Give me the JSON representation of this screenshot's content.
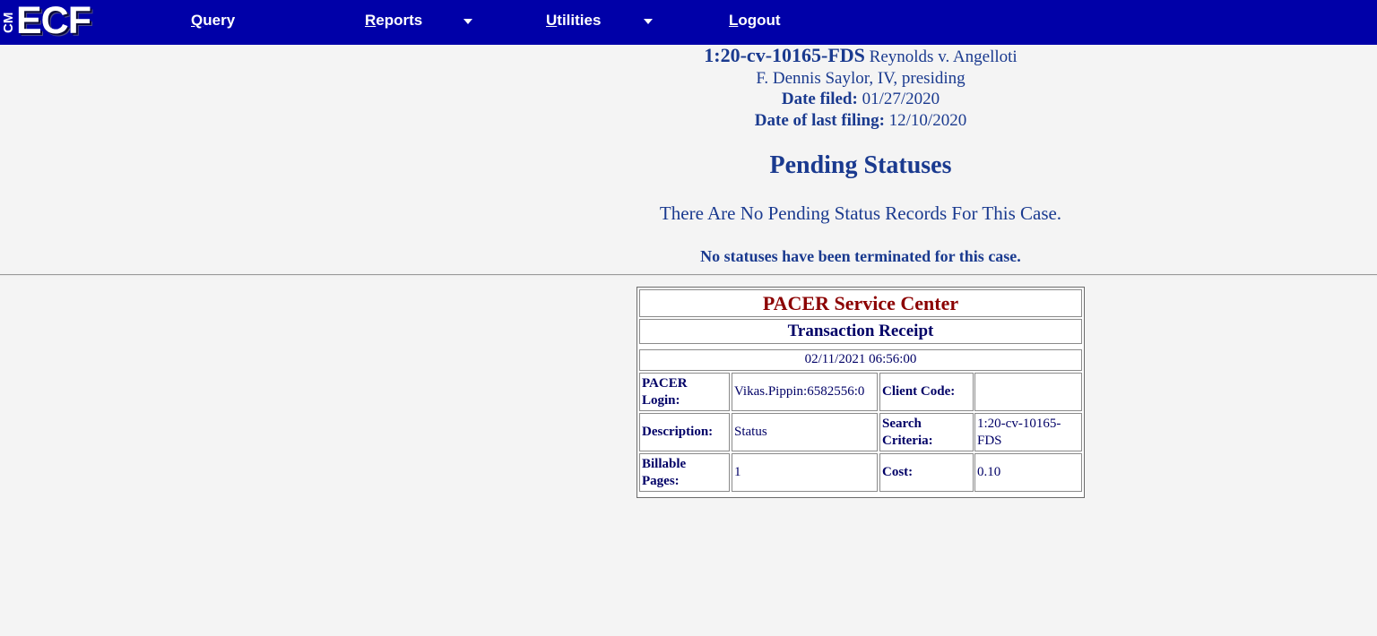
{
  "app": {
    "logo_prefix": "CM",
    "logo_main": "ECF"
  },
  "nav": {
    "query": {
      "accel": "Q",
      "rest": "uery"
    },
    "reports": {
      "accel": "R",
      "rest": "eports"
    },
    "utilities": {
      "accel": "U",
      "rest": "tilities"
    },
    "logout": {
      "accel": "L",
      "rest": "ogout"
    }
  },
  "case": {
    "number": "1:20-cv-10165-FDS",
    "title": " Reynolds v. Angelloti",
    "judge": "F. Dennis Saylor, IV, presiding",
    "date_filed_label": "Date filed:",
    "date_filed": " 01/27/2020",
    "last_filing_label": "Date of last filing:",
    "last_filing": " 12/10/2020"
  },
  "page": {
    "title": "Pending Statuses",
    "no_pending": "There Are No Pending Status Records For This Case.",
    "no_terminated": "No statuses have been terminated for this case."
  },
  "receipt": {
    "service_center": "PACER Service Center",
    "receipt_title": "Transaction Receipt",
    "timestamp": "02/11/2021 06:56:00",
    "rows": [
      {
        "label1_a": "PACER",
        "label1_b": "Login:",
        "value1": "Vikas.Pippin:6582556:0",
        "label2_a": "Client Code:",
        "label2_b": "",
        "value2_a": "",
        "value2_b": ""
      },
      {
        "label1_a": "Description:",
        "label1_b": "",
        "value1": "Status",
        "label2_a": "Search",
        "label2_b": "Criteria:",
        "value2_a": "1:20-cv-10165-",
        "value2_b": "FDS"
      },
      {
        "label1_a": "Billable",
        "label1_b": "Pages:",
        "value1": "1",
        "label2_a": "Cost:",
        "label2_b": "",
        "value2_a": "0.10",
        "value2_b": ""
      }
    ]
  },
  "colors": {
    "nav_bg": "#0000a8",
    "page_bg": "#f4f4f4",
    "heading_blue": "#1a3a8f",
    "pacer_red": "#8b0000",
    "table_text": "#000066"
  }
}
